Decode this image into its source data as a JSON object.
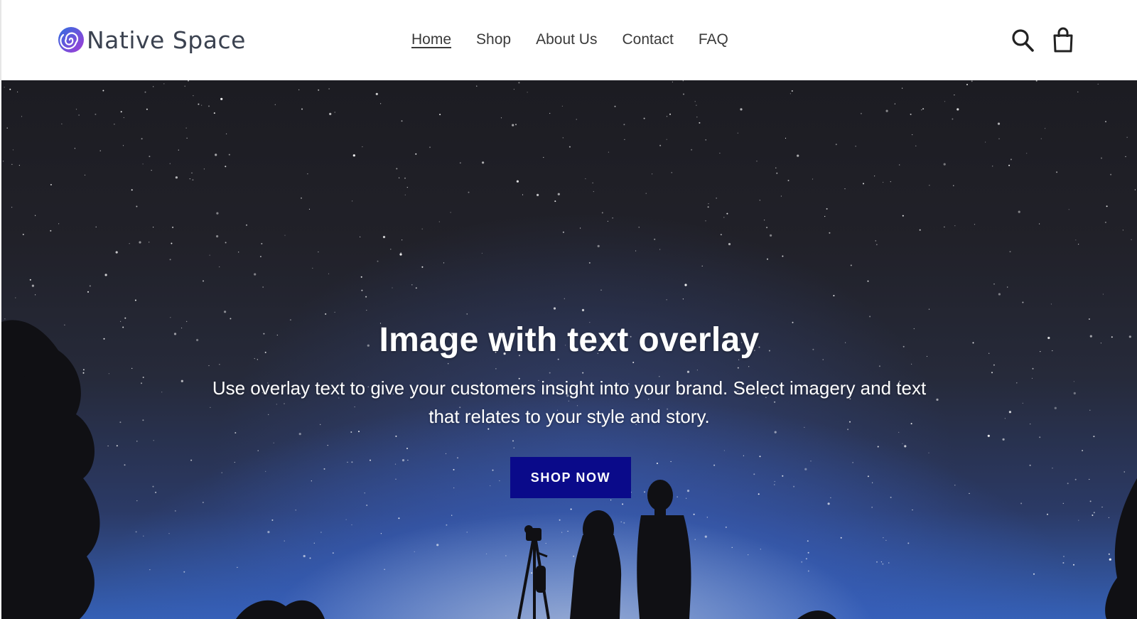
{
  "brand": {
    "name": "Native Space",
    "logo_colors": [
      "#2f6fe0",
      "#a43bd6"
    ]
  },
  "nav": {
    "items": [
      {
        "label": "Home",
        "active": true
      },
      {
        "label": "Shop",
        "active": false
      },
      {
        "label": "About Us",
        "active": false
      },
      {
        "label": "Contact",
        "active": false
      },
      {
        "label": "FAQ",
        "active": false
      }
    ]
  },
  "header_icons": {
    "search": "search-icon",
    "cart": "shopping-bag-icon"
  },
  "hero": {
    "title": "Image with text overlay",
    "subtitle": "Use overlay text to give your customers insight into your brand. Select imagery and text that relates to your style and story.",
    "button_label": "SHOP NOW",
    "button_color": "#0a0a8a"
  },
  "colors": {
    "header_bg": "#ffffff",
    "nav_text": "#3a3a3a",
    "sky_dark": "#1c1c22",
    "sky_glow": "#3560b5"
  }
}
